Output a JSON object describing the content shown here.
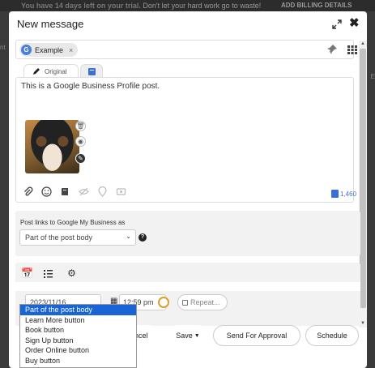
{
  "background": {
    "trial_prefix": "You have",
    "trial_days": "14 days left on your trial.",
    "trial_suffix": "Don't let your hard work go to waste!",
    "billing": "ADD BILLING DETAILS",
    "left_edge": "nt",
    "right_edge": "E"
  },
  "modal": {
    "title": "New message"
  },
  "profile": {
    "chip_logo": "G",
    "chip_label": "Example",
    "chip_remove": "×"
  },
  "tabs": {
    "original": "Original"
  },
  "editor": {
    "text": "This is a Google Business Profile post.",
    "char_count": "1,460"
  },
  "gmb": {
    "label": "Post links to Google My Business as",
    "selected": "Part of the post body",
    "help": "?",
    "options": [
      "Part of the post body",
      "Learn More button",
      "Book button",
      "Sign Up button",
      "Order Online button",
      "Buy button"
    ]
  },
  "schedule": {
    "date": "2023/11/16",
    "time": "12:59 pm",
    "repeat": "Repeat..."
  },
  "footer": {
    "cancel": "ancel",
    "save": "Save",
    "approval": "Send For Approval",
    "schedule": "Schedule"
  },
  "colors": {
    "accent": "#1a64d6",
    "char_count": "#4a6cd6",
    "clock": "#d7a02c"
  },
  "icons": [
    "expand-icon",
    "close-icon",
    "pin-icon",
    "grid-icon",
    "pencil-icon",
    "book-icon",
    "trash-icon",
    "camera-icon",
    "paperclip-icon",
    "emoji-icon",
    "eye-icon",
    "location-icon",
    "image-icon",
    "calendar-icon",
    "list-icon",
    "gear-icon",
    "clock-icon",
    "chevron-down-icon"
  ]
}
